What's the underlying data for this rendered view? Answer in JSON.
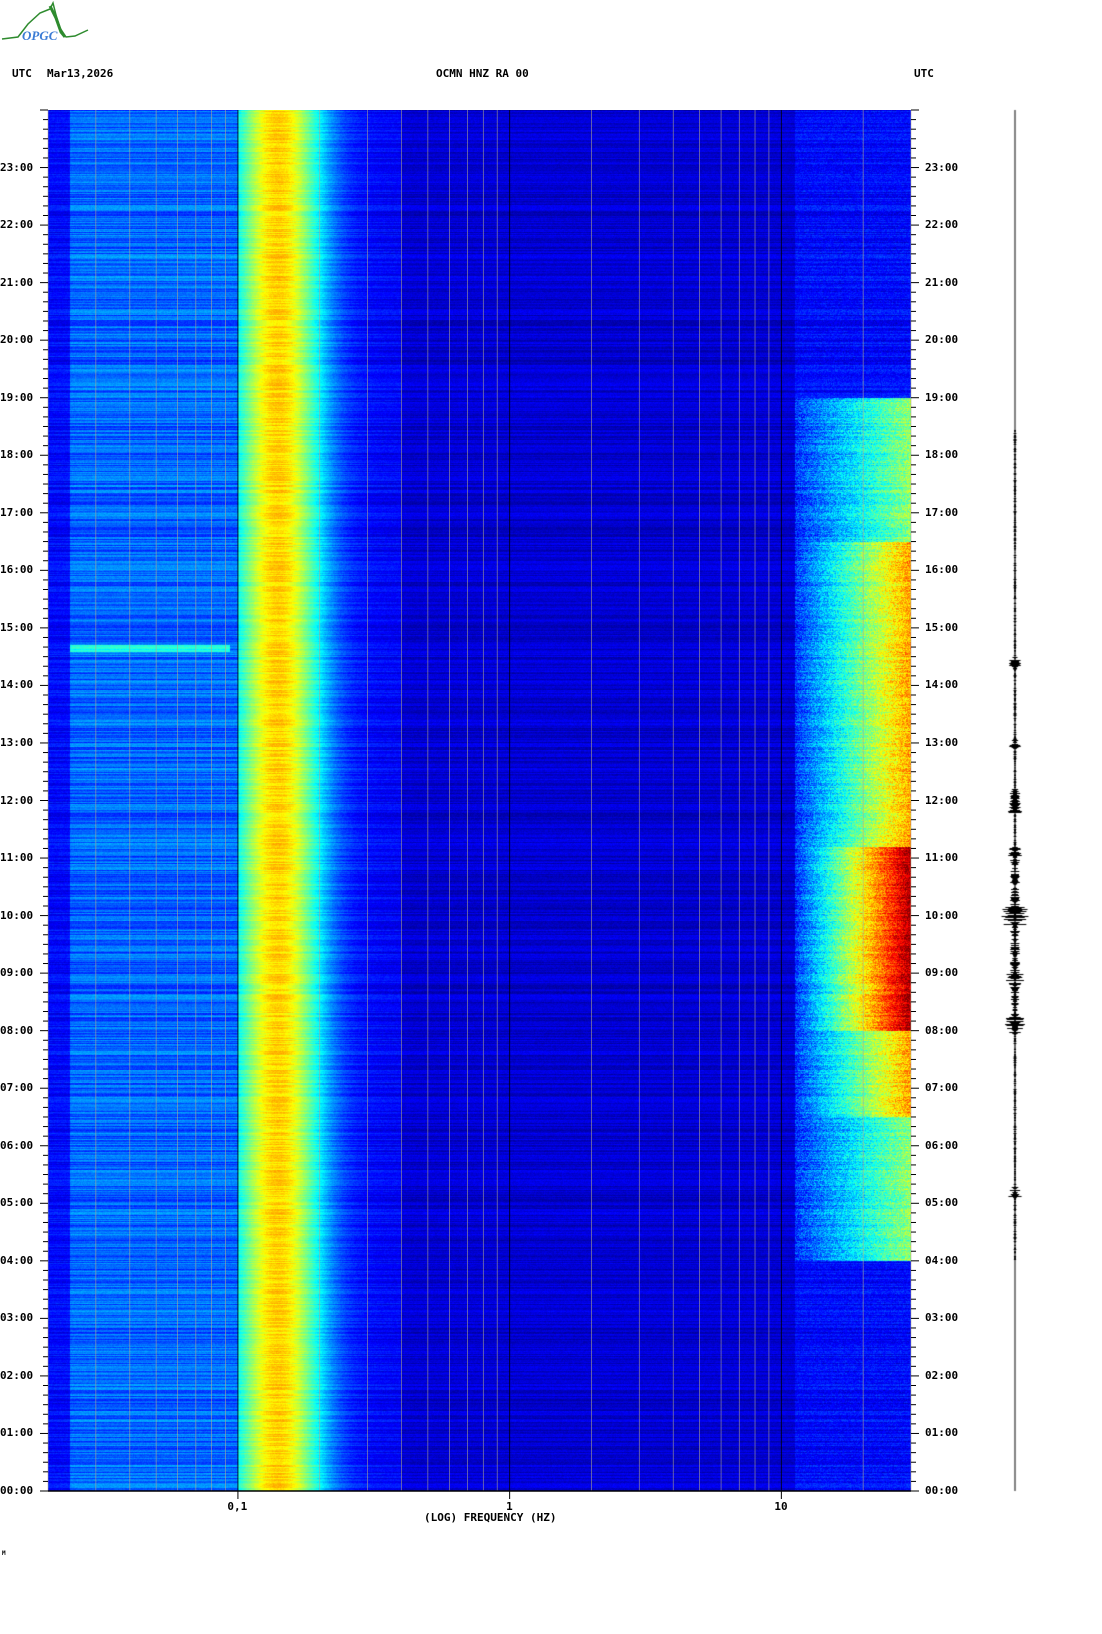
{
  "header": {
    "logo_text": "OPGC",
    "left_tz": "UTC",
    "date": "Mar13,2026",
    "station": "OCMN HNZ RA 00",
    "right_tz": "UTC"
  },
  "footer_mark": "M",
  "chart_data": {
    "type": "heatmap",
    "title": "OCMN HNZ RA 00",
    "xlabel": "(LOG) FREQUENCY (HZ)",
    "ylabel": "UTC",
    "x_scale": "log",
    "xlim": [
      0.02,
      30
    ],
    "x_ticks": [
      {
        "value": 0.1,
        "label": "0,1"
      },
      {
        "value": 1,
        "label": "1"
      },
      {
        "value": 10,
        "label": "10"
      }
    ],
    "ylim_hours": [
      0,
      24
    ],
    "y_ticks": [
      "00:00",
      "01:00",
      "02:00",
      "03:00",
      "04:00",
      "05:00",
      "06:00",
      "07:00",
      "08:00",
      "09:00",
      "10:00",
      "11:00",
      "12:00",
      "13:00",
      "14:00",
      "15:00",
      "16:00",
      "17:00",
      "18:00",
      "19:00",
      "20:00",
      "21:00",
      "22:00",
      "23:00"
    ],
    "colormap": "jet",
    "features": {
      "microseism_peak_hz": 0.14,
      "high_freq_activity_hours": [
        4,
        19
      ],
      "strongest_activity_hours": [
        8,
        11.2
      ],
      "low_freq_transient_hour": 14.65
    }
  }
}
